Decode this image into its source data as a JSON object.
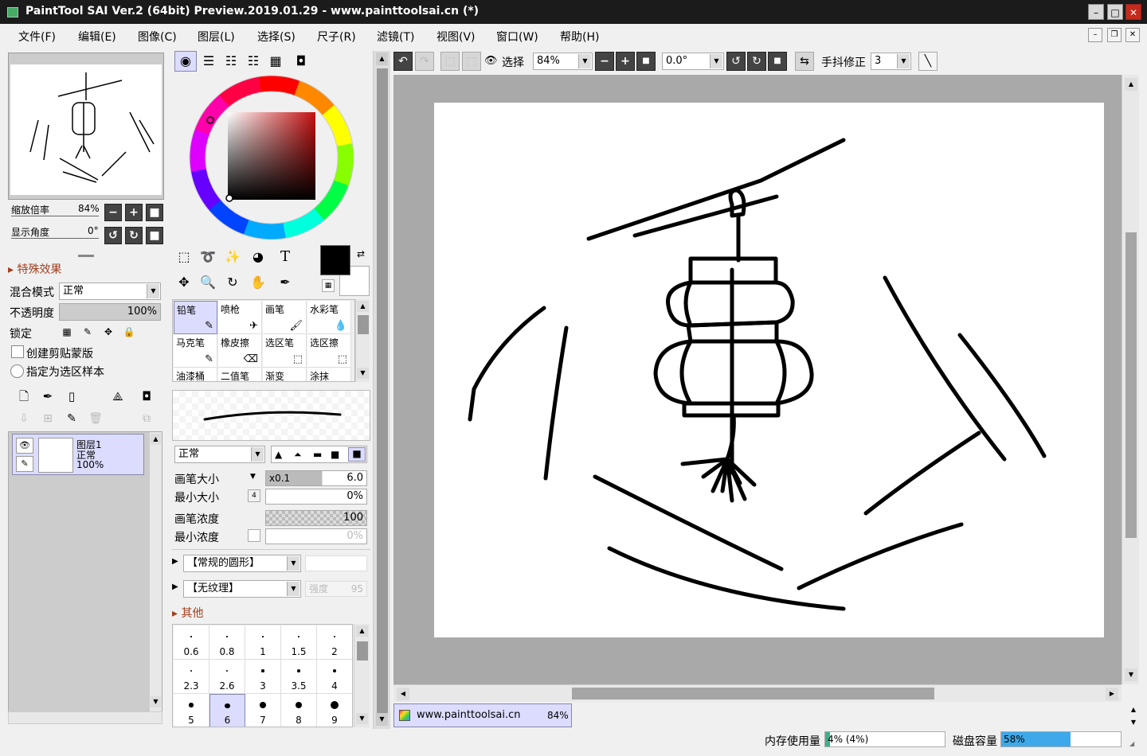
{
  "window": {
    "title": "PaintTool SAI Ver.2 (64bit) Preview.2019.01.29 - www.painttoolsai.cn (*)",
    "minimize": "–",
    "maximize": "□",
    "close": "✕"
  },
  "menu": [
    "文件(F)",
    "编辑(E)",
    "图像(C)",
    "图层(L)",
    "选择(S)",
    "尺子(R)",
    "滤镜(T)",
    "视图(V)",
    "窗口(W)",
    "帮助(H)"
  ],
  "navigator": {
    "zoom_label": "缩放倍率",
    "zoom_value": "84%",
    "angle_label": "显示角度",
    "angle_value": "0°"
  },
  "layer_props": {
    "effects_label": "特殊效果",
    "blend_label": "混合模式",
    "blend_value": "正常",
    "opacity_label": "不透明度",
    "opacity_value": "100%",
    "lock_label": "锁定",
    "clip_label": "创建剪贴蒙版",
    "sample_label": "指定为选区样本"
  },
  "layers": [
    {
      "name": "图层1",
      "mode": "正常",
      "opacity": "100%"
    }
  ],
  "brushes": [
    {
      "name": "铅笔",
      "selected": true
    },
    {
      "name": "喷枪"
    },
    {
      "name": "画笔"
    },
    {
      "name": "水彩笔"
    },
    {
      "name": "马克笔"
    },
    {
      "name": "橡皮擦"
    },
    {
      "name": "选区笔"
    },
    {
      "name": "选区擦"
    },
    {
      "name": "油漆桶"
    },
    {
      "name": "二值笔"
    },
    {
      "name": "渐变"
    },
    {
      "name": "涂抹"
    }
  ],
  "brush_settings": {
    "mode_value": "正常",
    "size_label": "画笔大小",
    "size_mult": "x0.1",
    "size_value": "6.0",
    "minsize_label": "最小大小",
    "minsize_value": "0%",
    "density_label": "画笔浓度",
    "density_value": "100",
    "mindensity_label": "最小浓度",
    "mindensity_value": "0%",
    "shape_value": "【常规的圆形】",
    "texture_value": "【无纹理】",
    "texture_strength_label": "强度",
    "texture_strength_value": "95",
    "other_label": "其他"
  },
  "brush_sizes": [
    "0.6",
    "0.8",
    "1",
    "1.5",
    "2",
    "2.3",
    "2.6",
    "3",
    "3.5",
    "4",
    "5",
    "6",
    "7",
    "8",
    "9"
  ],
  "selected_brush_size": "6",
  "canvas_toolbar": {
    "select_label": "选择",
    "zoom_value": "84%",
    "angle_value": "0.0°",
    "stabilizer_label": "手抖修正",
    "stabilizer_value": "3"
  },
  "document_tab": {
    "name": "www.painttoolsai.cn",
    "zoom": "84%"
  },
  "status": {
    "memory_label": "内存使用量",
    "memory_value": "4% (4%)",
    "memory_fraction": 0.04,
    "disk_label": "磁盘容量",
    "disk_value": "58%",
    "disk_fraction": 0.58
  },
  "colors": {
    "foreground": "#000000",
    "background": "#ffffff",
    "accent": "#dcdcff",
    "title_bar": "#1b1b1b",
    "close_button": "#c42b1c",
    "disk_bar": "#3da9ea",
    "memory_bar": "#3fb08a"
  }
}
